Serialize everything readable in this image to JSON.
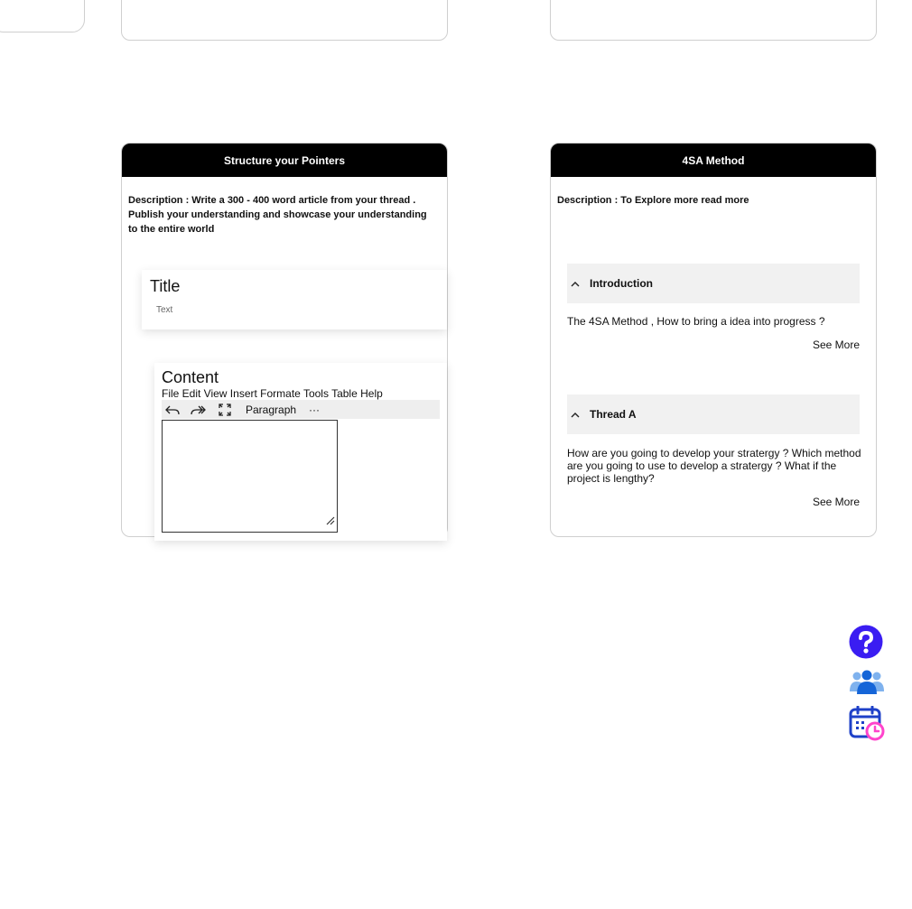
{
  "left_card": {
    "header": "Structure your Pointers",
    "description": "Description : Write a 300 - 400 word article from your thread . Publish your understanding and showcase your understanding to the entire world",
    "title_panel": {
      "heading": "Title",
      "placeholder": "Text"
    },
    "content_panel": {
      "heading": "Content",
      "menu": "File Edit View Insert Formate Tools Table Help",
      "toolbar": {
        "block_format": "Paragraph",
        "more": "···"
      }
    }
  },
  "right_card": {
    "header": "4SA Method",
    "description": "Description : To Explore more read more",
    "sections": [
      {
        "title": "Introduction",
        "body": "The 4SA Method , How to bring a idea into progress ?",
        "see_more": "See More"
      },
      {
        "title": "Thread A",
        "body": "How are you going to develop your stratergy ? Which method are you going to use to develop a stratergy ? What if the project is lengthy?",
        "see_more": "See More"
      }
    ]
  },
  "floating_actions": {
    "icons": [
      "help-icon",
      "team-icon",
      "calendar-clock-icon"
    ],
    "colors": {
      "help": "#3a1df2",
      "team_front": "#1565d8",
      "team_back": "#7fb2ee",
      "calendar": "#1e40c8",
      "clock": "#ff44cc"
    }
  }
}
